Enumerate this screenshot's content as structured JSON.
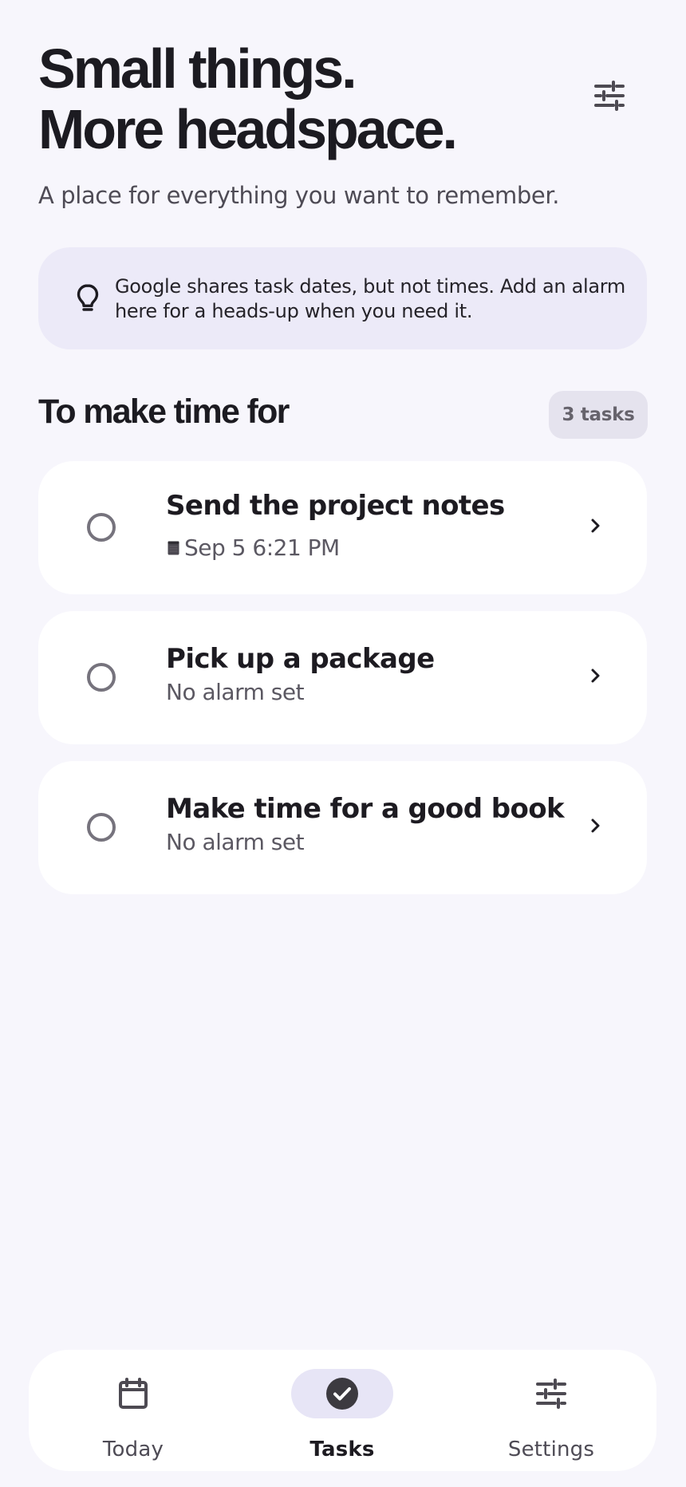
{
  "header": {
    "title_line_1": "Small things.",
    "title_line_2": "More headspace.",
    "subtitle": "A place for everything you want to remember.",
    "filter_icon": "tune-icon"
  },
  "info_banner": {
    "icon": "lightbulb-icon",
    "text": "Google shares task dates, but not times. Add an alarm here for a heads-up when you need it."
  },
  "section": {
    "title": "To make time for",
    "count_label": "3 tasks"
  },
  "tasks": [
    {
      "title": "Send the project notes",
      "subline": "Sep 5 6:21 PM",
      "subline_icon": "calendar-icon",
      "trailing_icon": "chevron-right-icon"
    },
    {
      "title": "Pick up a package",
      "subline": "No alarm set",
      "trailing_icon": "chevron-right-icon"
    },
    {
      "title": "Make time for a good book",
      "subline": "No alarm set",
      "trailing_icon": "chevron-right-icon"
    }
  ],
  "bottom_nav": {
    "items": [
      {
        "label": "Today",
        "icon": "calendar-icon",
        "selected": false
      },
      {
        "label": "Tasks",
        "icon": "check-circle-icon",
        "selected": true
      },
      {
        "label": "Settings",
        "icon": "tune-icon",
        "selected": false
      }
    ]
  },
  "colors": {
    "background": "#f7f6fc",
    "surface": "#ffffff",
    "info_background": "#eceaf8",
    "selected_nav_background": "#e7e5f6",
    "primary_text": "#1d1b21",
    "secondary_text": "#5b5862"
  }
}
